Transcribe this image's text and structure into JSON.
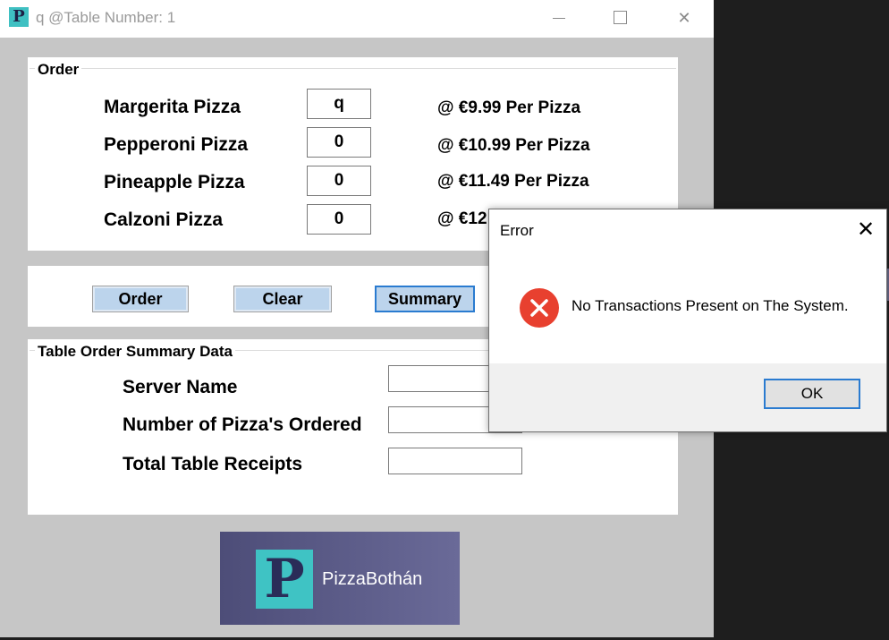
{
  "window": {
    "title": "q @Table Number: 1",
    "icon_letter": "P",
    "controls": {
      "minimize": "minimize-icon",
      "maximize": "maximize-icon",
      "close": "✕"
    }
  },
  "order": {
    "group_title": "Order",
    "items": [
      {
        "name": "Margerita Pizza",
        "qty": "q",
        "price": "@ €9.99 Per Pizza"
      },
      {
        "name": "Pepperoni Pizza",
        "qty": "0",
        "price": "@ €10.99 Per Pizza"
      },
      {
        "name": "Pineapple Pizza",
        "qty": "0",
        "price": "@ €11.49 Per Pizza"
      },
      {
        "name": "Calzoni Pizza",
        "qty": "0",
        "price": "@ €12"
      }
    ]
  },
  "buttons": {
    "order": "Order",
    "clear": "Clear",
    "summary": "Summary"
  },
  "summary": {
    "group_title": "Table Order Summary Data",
    "labels": [
      "Server Name",
      "Number of Pizza's Ordered",
      "Total Table Receipts"
    ],
    "values": [
      "",
      "",
      ""
    ]
  },
  "logo": {
    "letter": "P",
    "text": "PizzaBothán"
  },
  "dialog": {
    "title": "Error",
    "close": "✕",
    "message": "No Transactions Present on The System.",
    "ok": "OK",
    "icon": "error-icon"
  },
  "colors": {
    "accent": "#2a7bd0",
    "button_bg": "#bcd4ec",
    "brand_teal": "#3fc3c4",
    "brand_purple": "#5a5a88",
    "error_red": "#e8402f"
  }
}
